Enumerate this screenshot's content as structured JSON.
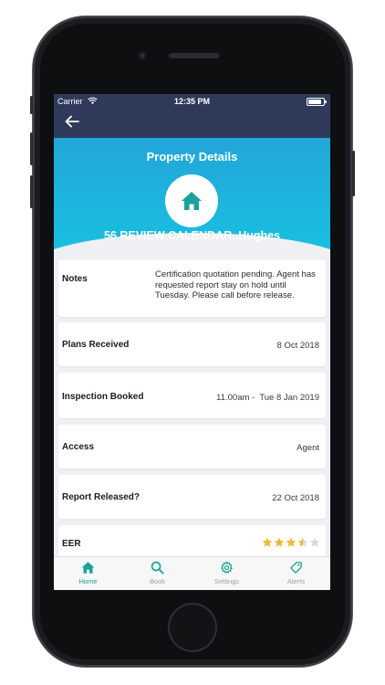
{
  "status_bar": {
    "carrier": "Carrier",
    "time": "12:35 PM",
    "battery_percent": 90
  },
  "nav": {
    "back_icon": "arrow-left-icon"
  },
  "header": {
    "title": "Property Details",
    "property_icon": "home-icon",
    "address": "56 REVIEW CALENDAR, Hughes"
  },
  "details": {
    "notes": {
      "label": "Notes",
      "value": "Certification quotation pending. Agent has requested report stay on hold until Tuesday. Please call before release."
    },
    "plans_received": {
      "label": "Plans Received",
      "value": "8 Oct 2018"
    },
    "inspection_booked": {
      "label": "Inspection Booked",
      "value": "11.00am -  Tue 8 Jan 2019"
    },
    "access": {
      "label": "Access",
      "value": "Agent"
    },
    "report_released": {
      "label": "Report Released?",
      "value": "22 Oct 2018"
    },
    "eer": {
      "label": "EER",
      "rating": 3.5,
      "max": 5
    }
  },
  "tabs": [
    {
      "label": "Home",
      "icon": "home-icon",
      "active": true
    },
    {
      "label": "Book",
      "icon": "search-icon",
      "active": false
    },
    {
      "label": "Settings",
      "icon": "gear-icon",
      "active": false
    },
    {
      "label": "Alerts",
      "icon": "tag-icon",
      "active": false
    }
  ],
  "colors": {
    "nav_bg": "#2f3a5a",
    "header_gradient_top": "#23a6d9",
    "header_gradient_bottom": "#18bfe0",
    "accent": "#1aa19a",
    "star_filled": "#f2b632",
    "star_empty": "#d8d8d8"
  }
}
